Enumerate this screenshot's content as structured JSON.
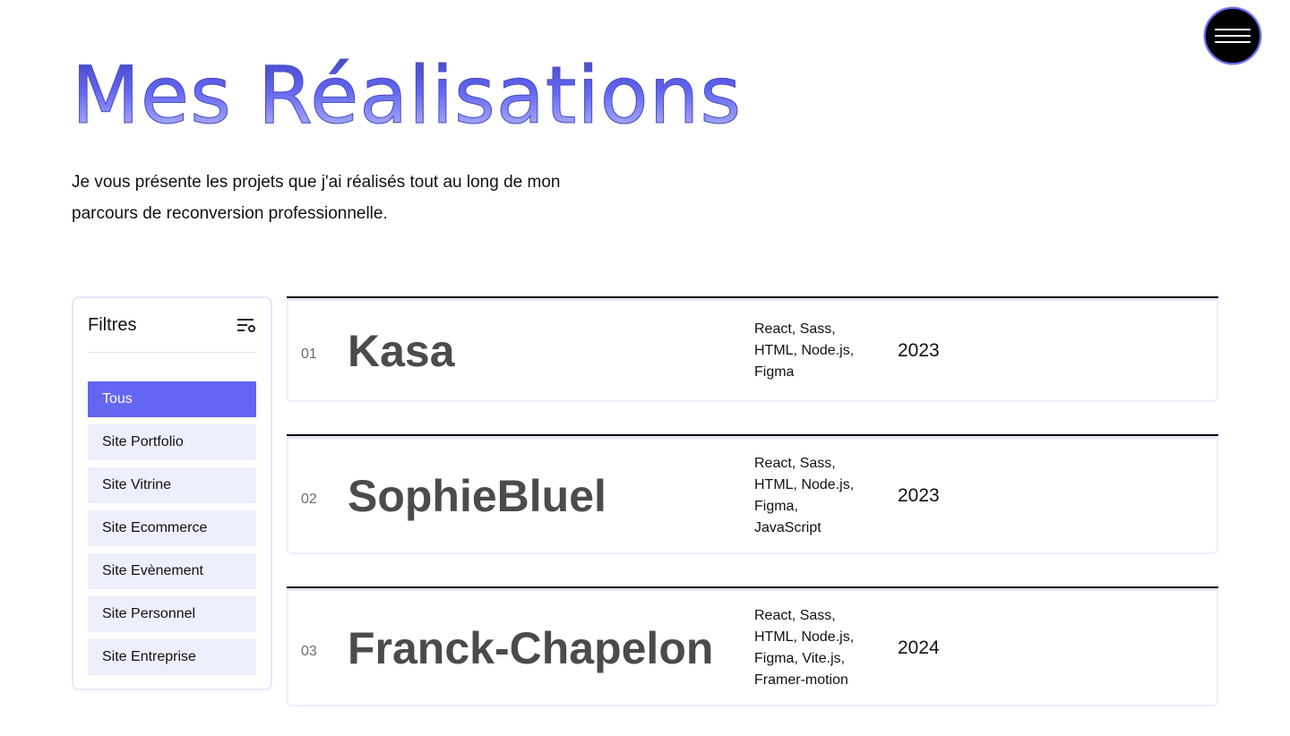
{
  "header": {
    "title": "Mes Réalisations",
    "intro_line1": "Je vous présente les projets que j'ai réalisés tout au long de mon",
    "intro_line2": "parcours de reconversion professionnelle.",
    "menu_icon": "hamburger-icon"
  },
  "filters": {
    "title": "Filtres",
    "icon": "filter-settings-icon",
    "items": [
      {
        "label": "Tous",
        "active": true
      },
      {
        "label": "Site Portfolio",
        "active": false
      },
      {
        "label": "Site Vitrine",
        "active": false
      },
      {
        "label": "Site Ecommerce",
        "active": false
      },
      {
        "label": "Site Evènement",
        "active": false
      },
      {
        "label": "Site Personnel",
        "active": false
      },
      {
        "label": "Site Entreprise",
        "active": false
      }
    ]
  },
  "projects": [
    {
      "num": "01",
      "name": "Kasa",
      "tech": [
        "React, Sass,",
        "HTML, Node.js,",
        "Figma"
      ],
      "year": "2023"
    },
    {
      "num": "02",
      "name": "SophieBluel",
      "tech": [
        "React, Sass,",
        "HTML, Node.js,",
        "Figma,",
        "JavaScript"
      ],
      "year": "2023"
    },
    {
      "num": "03",
      "name": "Franck-Chapelon",
      "tech": [
        "React, Sass,",
        "HTML, Node.js,",
        "Figma, Vite.js,",
        "Framer-motion"
      ],
      "year": "2024"
    }
  ],
  "colors": {
    "accent": "#6366f1",
    "filter_bg": "#eeeffd",
    "project_name": "#4b4b4b"
  }
}
